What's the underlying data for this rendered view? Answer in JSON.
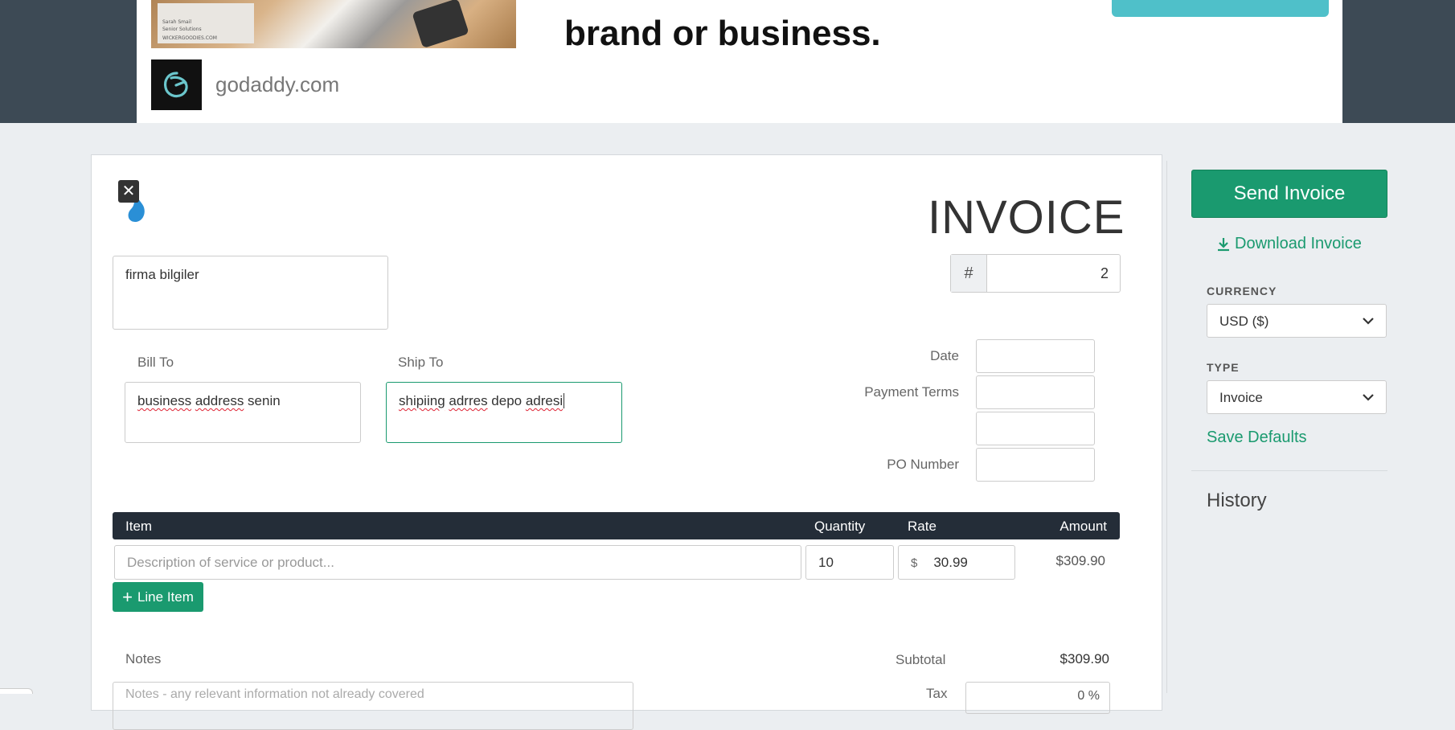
{
  "ad": {
    "headline": "brand or business.",
    "domain": "godaddy.com",
    "photo_card_line1": "Sarah Smail",
    "photo_card_line2": "Senior Solutions",
    "photo_card_line3": "WICKERGOODIES.COM"
  },
  "invoice": {
    "title": "INVOICE",
    "number_prefix": "#",
    "number": "2",
    "from_text": "firma bilgiler",
    "bill_to_label": "Bill To",
    "bill_to_text": [
      "business",
      " ",
      "address",
      " senin"
    ],
    "ship_to_label": "Ship To",
    "ship_to_text": [
      "shipiing",
      " ",
      "adrres",
      " depo ",
      "adresi"
    ],
    "meta": {
      "date_label": "Date",
      "payment_terms_label": "Payment Terms",
      "po_number_label": "PO Number"
    },
    "table": {
      "headers": {
        "item": "Item",
        "quantity": "Quantity",
        "rate": "Rate",
        "amount": "Amount"
      },
      "rows": [
        {
          "description_placeholder": "Description of service or product...",
          "quantity": "10",
          "currency_symbol": "$",
          "rate": "30.99",
          "amount": "$309.90"
        }
      ]
    },
    "line_item_button": "Line Item",
    "notes_label": "Notes",
    "notes_placeholder": "Notes - any relevant information not already covered",
    "subtotal_label": "Subtotal",
    "subtotal_value": "$309.90",
    "tax_label": "Tax",
    "tax_value": "0 %"
  },
  "sidebar": {
    "send_button": "Send Invoice",
    "download_link": "Download Invoice",
    "currency_label": "CURRENCY",
    "currency_value": "USD ($)",
    "type_label": "TYPE",
    "type_value": "Invoice",
    "save_defaults": "Save Defaults",
    "history_title": "History"
  },
  "colors": {
    "accent_green": "#1a9a6f",
    "table_header": "#242d38",
    "ad_background": "#3d4a55",
    "ad_cta": "#4fc0c9",
    "logo_blue": "#2a8fd6"
  }
}
